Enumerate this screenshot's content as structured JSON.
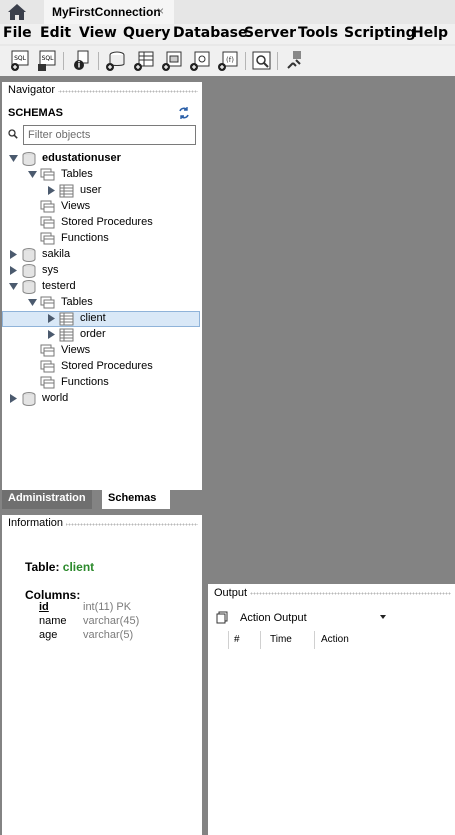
{
  "connection_tab": {
    "title": "MyFirstConnection",
    "close": "×"
  },
  "menu": [
    "File",
    "Edit",
    "View",
    "Query",
    "Database",
    "Server",
    "Tools",
    "Scripting",
    "Help"
  ],
  "toolbar": {
    "new_sql_label": "SQL",
    "open_sql_label": "SQL",
    "icons": [
      "new-sql-tab-icon",
      "open-sql-script-icon",
      "schema-inspector-icon",
      "create-schema-icon",
      "create-table-icon",
      "create-view-icon",
      "create-procedure-icon",
      "create-function-icon",
      "search-table-data-icon",
      "reconnect-icon"
    ]
  },
  "navigator": {
    "title": "Navigator",
    "schemas_label": "SCHEMAS",
    "filter_placeholder": "Filter objects",
    "tree": {
      "edustationuser": "edustationuser",
      "tables": "Tables",
      "user": "user",
      "views": "Views",
      "stored_procedures": "Stored Procedures",
      "functions": "Functions",
      "sakila": "sakila",
      "sys": "sys",
      "testerd": "testerd",
      "tables2": "Tables",
      "client": "client",
      "order": "order",
      "views2": "Views",
      "stored_procedures2": "Stored Procedures",
      "functions2": "Functions",
      "world": "world"
    }
  },
  "bottom_tabs": {
    "administration": "Administration",
    "schemas": "Schemas"
  },
  "information": {
    "title": "Information",
    "table_label": "Table:",
    "table_name": "client",
    "columns_label": "Columns:",
    "columns": [
      {
        "name": "id",
        "type": "int(11) PK"
      },
      {
        "name": "name",
        "type": "varchar(45)"
      },
      {
        "name": "age",
        "type": "varchar(5)"
      }
    ]
  },
  "output": {
    "title": "Output",
    "selector_value": "Action Output",
    "columns": [
      "#",
      "Time",
      "Action"
    ]
  },
  "colors": {
    "workspace": "#838383",
    "selected_row": "#d9e8f7",
    "table_name_green": "#2c8a2c"
  }
}
